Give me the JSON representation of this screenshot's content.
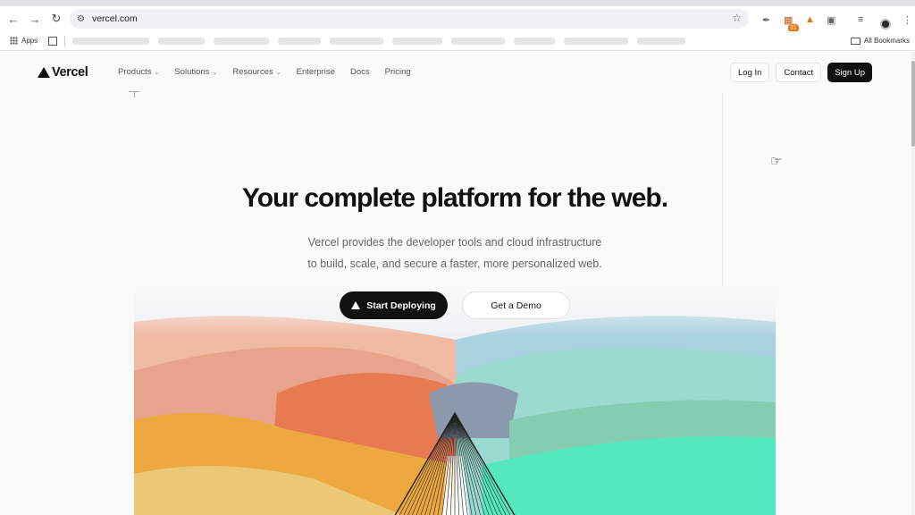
{
  "browser": {
    "url": "vercel.com",
    "extension_badge": "31",
    "bookmarks": {
      "apps_label": "Apps",
      "all_bookmarks_label": "All Bookmarks"
    }
  },
  "nav": {
    "brand": "Vercel",
    "menu": [
      {
        "label": "Products",
        "has_dropdown": true
      },
      {
        "label": "Solutions",
        "has_dropdown": true
      },
      {
        "label": "Resources",
        "has_dropdown": true
      },
      {
        "label": "Enterprise",
        "has_dropdown": false
      },
      {
        "label": "Docs",
        "has_dropdown": false
      },
      {
        "label": "Pricing",
        "has_dropdown": false
      }
    ],
    "login_label": "Log In",
    "contact_label": "Contact",
    "signup_label": "Sign Up"
  },
  "hero": {
    "title": "Your complete platform for the web.",
    "subtitle_line1": "Vercel provides the developer tools and cloud infrastructure",
    "subtitle_line2": "to build, scale, and secure a faster, more personalized web.",
    "primary_cta": "Start Deploying",
    "secondary_cta": "Get a Demo"
  },
  "colors": {
    "brand_dark": "#111111",
    "art_peach": "#f0b9a2",
    "art_coral": "#e87a52",
    "art_orange": "#eda83f",
    "art_yellow": "#ecc876",
    "art_sky": "#a9d2e0",
    "art_teal": "#9bdad0",
    "art_mint": "#55e8bf",
    "art_gray_blue": "#8c99ad"
  }
}
